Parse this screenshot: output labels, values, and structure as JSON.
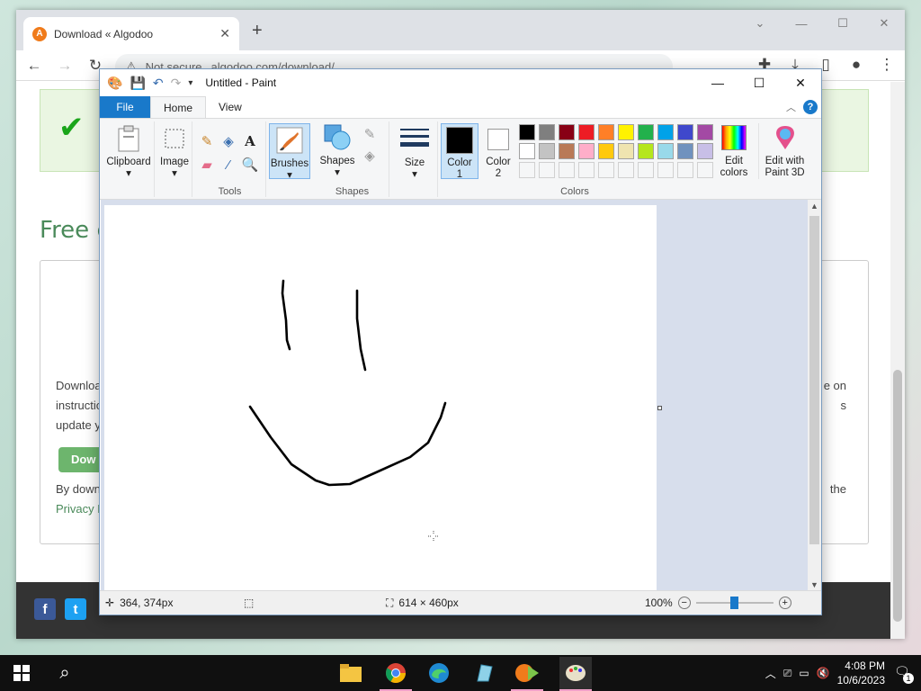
{
  "browser": {
    "tab_title": "Download « Algodoo",
    "tab_close": "✕",
    "new_tab": "+",
    "url_security": "Not secure",
    "url": "algodoo.com/download/"
  },
  "webpage": {
    "heading": "Free c",
    "card_line1": "Downloa",
    "card_line2": "instructio",
    "card_line3": "update y",
    "card_right1": "e on",
    "card_right2": "s",
    "download_btn": "Dow",
    "bydown": "By down",
    "privacy": "Privacy P",
    "right_the": "the"
  },
  "paint": {
    "title": "Untitled - Paint",
    "tabs": {
      "file": "File",
      "home": "Home",
      "view": "View"
    },
    "ribbon": {
      "clipboard": "Clipboard",
      "image": "Image",
      "tools_group": "Tools",
      "brushes": "Brushes",
      "shapes": "Shapes",
      "shapes_group": "Shapes",
      "size": "Size",
      "color1_line1": "Color",
      "color1_line2": "1",
      "color2_line1": "Color",
      "color2_line2": "2",
      "edit_colors_line1": "Edit",
      "edit_colors_line2": "colors",
      "edit3d_line1": "Edit with",
      "edit3d_line2": "Paint 3D",
      "colors_group": "Colors"
    },
    "palette_row1": [
      "#000000",
      "#7f7f7f",
      "#880015",
      "#ed1c24",
      "#ff7f27",
      "#fff200",
      "#22b14c",
      "#00a2e8",
      "#3f48cc",
      "#a349a4"
    ],
    "palette_row2": [
      "#ffffff",
      "#c3c3c3",
      "#b97a57",
      "#ffaec9",
      "#ffc90e",
      "#efe4b0",
      "#b5e61d",
      "#99d9ea",
      "#7092be",
      "#c8bfe7"
    ],
    "status": {
      "cursor_pos": "364, 374px",
      "canvas_size": "614 × 460px",
      "zoom": "100%"
    }
  },
  "taskbar": {
    "time": "4:08 PM",
    "date": "10/6/2023",
    "notif_count": "1"
  }
}
